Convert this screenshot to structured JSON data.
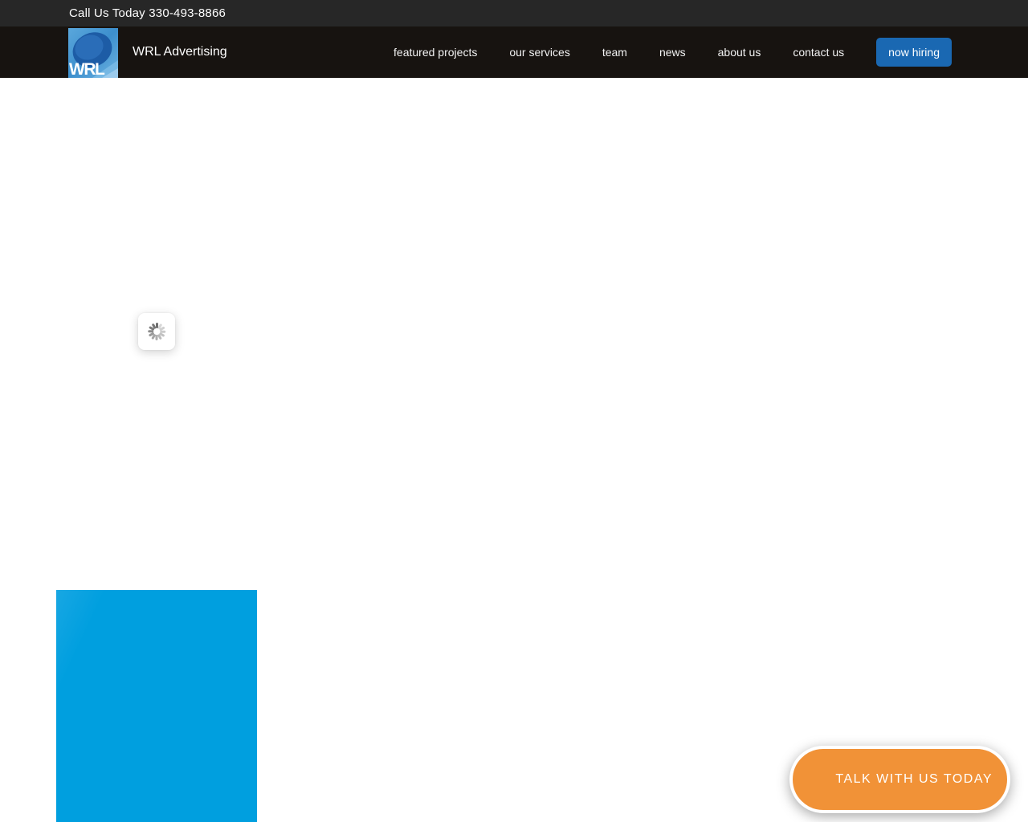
{
  "topbar": {
    "phone_label": "Call Us Today 330-493-8866"
  },
  "navbar": {
    "brand": "WRL Advertising",
    "logo_text": "WRL",
    "items": [
      {
        "label": "featured projects"
      },
      {
        "label": "our services"
      },
      {
        "label": "team"
      },
      {
        "label": "news"
      },
      {
        "label": "about us"
      },
      {
        "label": "contact us"
      }
    ],
    "hiring_button_label": "now hiring"
  },
  "main": {
    "cta_button_label": "TALK WITH US TODAY",
    "loading_state": "spinner"
  },
  "colors": {
    "topbar_bg": "#272727",
    "navbar_bg": "#171310",
    "hiring_blue": "#1a68b2",
    "cta_orange": "#f19237",
    "placeholder_blue": "#009fdf",
    "logo_light_blue": "#4d9fd8",
    "logo_dark_blue": "#1d5ca6"
  }
}
